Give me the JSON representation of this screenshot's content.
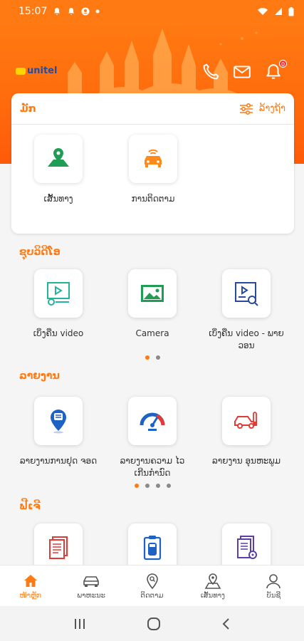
{
  "status_bar": {
    "time": "15:07",
    "left_icons": [
      "notification-bell-icon",
      "notification-bell-icon",
      "account-circle-icon",
      "dot-icon"
    ],
    "right_icons": [
      "wifi-icon",
      "signal-icon",
      "battery-icon"
    ]
  },
  "header": {
    "logo_text": "unitel",
    "notification_count": "0",
    "colors": {
      "brand": "#ff7a12"
    }
  },
  "favorites": {
    "title": "ມັກ",
    "edit_label": "ລ້າງຖ້າ",
    "items": [
      {
        "label": "ເສັ້ນທາງ",
        "icon": "map-route-icon"
      },
      {
        "label": "ການຕິດຕາມ",
        "icon": "car-tracking-icon"
      }
    ]
  },
  "sections": {
    "video": {
      "title": "ຊຸບວິດີໂອ",
      "items": [
        {
          "label": "ເບິ່ງຄືນ video",
          "icon": "video-playback-icon"
        },
        {
          "label": "Camera",
          "icon": "image-icon"
        },
        {
          "label": "ເບິ່ງຄືນ video - ພາຍວອນ",
          "icon": "video-search-icon"
        }
      ]
    },
    "reports": {
      "title": "ລາຍງານ",
      "items": [
        {
          "label": "ລາຍງານການຢຸດ ຈອດ",
          "icon": "parking-pin-icon"
        },
        {
          "label": "ລາຍງານຄວາມ ໄວເກີນກຳນົດ",
          "icon": "speedometer-icon"
        },
        {
          "label": "ລາຍງານ ອຸນຫະພູມ",
          "icon": "car-temperature-icon"
        }
      ]
    },
    "features": {
      "title": "ຟີເຈີ",
      "items": [
        {
          "label": "",
          "icon": "documents-icon"
        },
        {
          "label": "",
          "icon": "car-clipboard-icon"
        },
        {
          "label": "",
          "icon": "document-settings-icon"
        }
      ]
    }
  },
  "bottom_nav": [
    {
      "label": "ໜ້າຫຼັກ",
      "icon": "home-icon",
      "active": true
    },
    {
      "label": "ພາຫະນະ",
      "icon": "car-icon",
      "active": false
    },
    {
      "label": "ຕິດຕາມ",
      "icon": "location-search-icon",
      "active": false
    },
    {
      "label": "ເສັ້ນທາງ",
      "icon": "route-icon",
      "active": false
    },
    {
      "label": "ບັນຊີ",
      "icon": "user-icon",
      "active": false
    }
  ]
}
